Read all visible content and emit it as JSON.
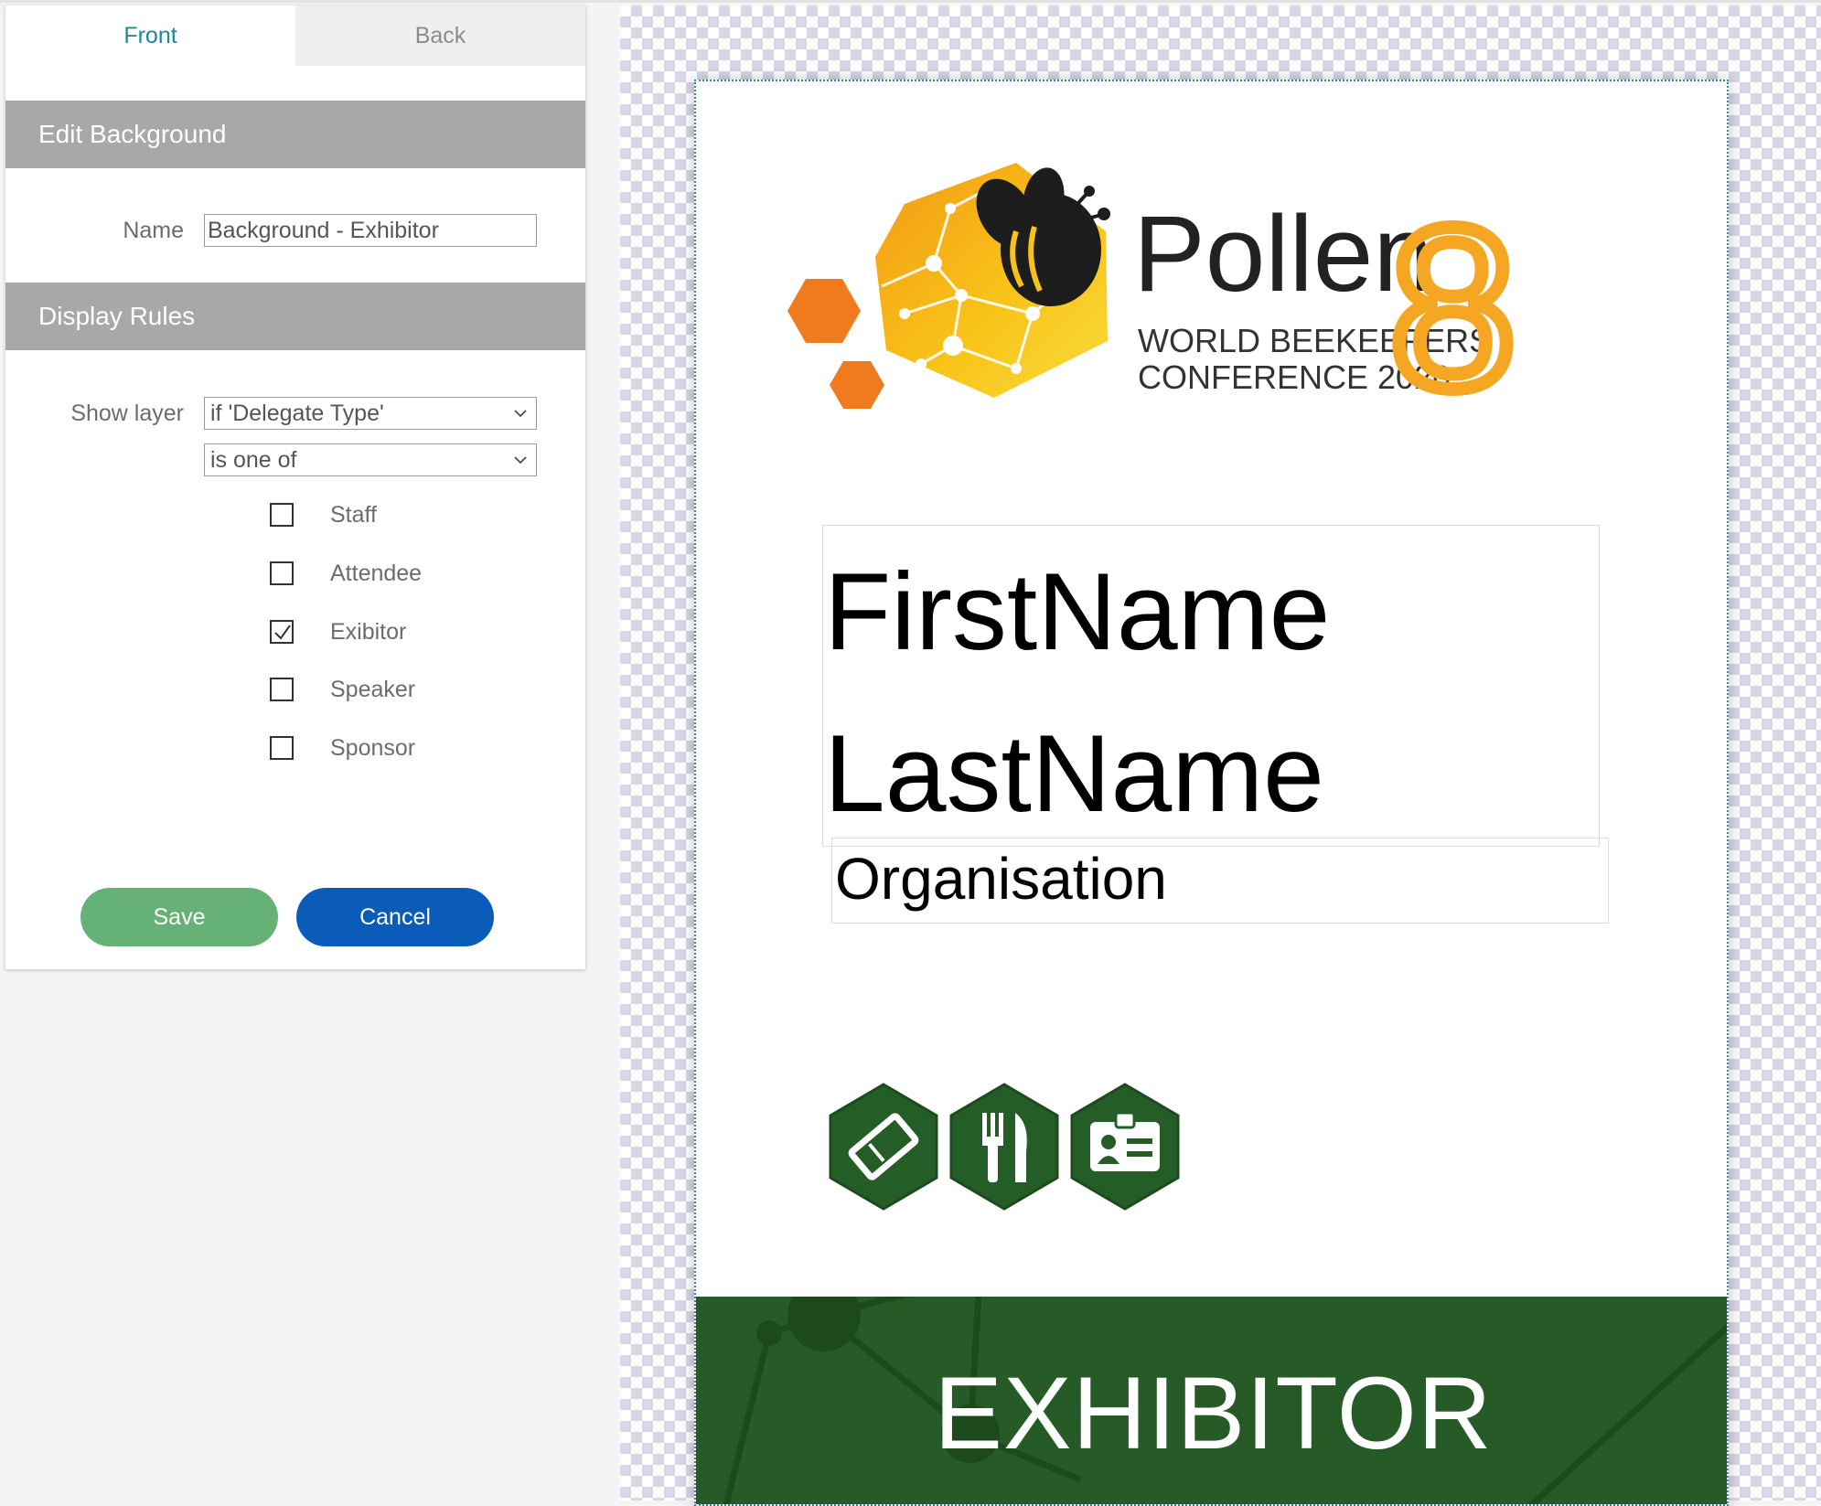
{
  "tabs": {
    "front": "Front",
    "back": "Back"
  },
  "edit_background": {
    "heading": "Edit Background",
    "name_label": "Name",
    "name_value": "Background - Exhibitor"
  },
  "display_rules": {
    "heading": "Display Rules",
    "show_layer_label": "Show layer",
    "condition_field": "if 'Delegate Type'",
    "condition_operator": "is one of",
    "options": [
      {
        "label": "Staff",
        "checked": false
      },
      {
        "label": "Attendee",
        "checked": false
      },
      {
        "label": "Exibitor",
        "checked": true
      },
      {
        "label": "Speaker",
        "checked": false
      },
      {
        "label": "Sponsor",
        "checked": false
      }
    ]
  },
  "buttons": {
    "save": "Save",
    "cancel": "Cancel"
  },
  "badge": {
    "logo_title": "Pollen",
    "logo_number": "8",
    "logo_line1": "WORLD BEEKEEPERS",
    "logo_line2": "CONFERENCE 2020",
    "first_name": "FirstName",
    "last_name": "LastName",
    "organisation": "Organisation",
    "icons": [
      "ticket-icon",
      "cutlery-icon",
      "id-card-icon"
    ],
    "footer_label": "EXHIBITOR"
  },
  "colors": {
    "accent_teal": "#1b8a96",
    "section_header": "#a8a8a8",
    "save_button": "#66b175",
    "cancel_button": "#0a5cb8",
    "badge_green": "#265a27",
    "logo_orange": "#f5a623"
  }
}
